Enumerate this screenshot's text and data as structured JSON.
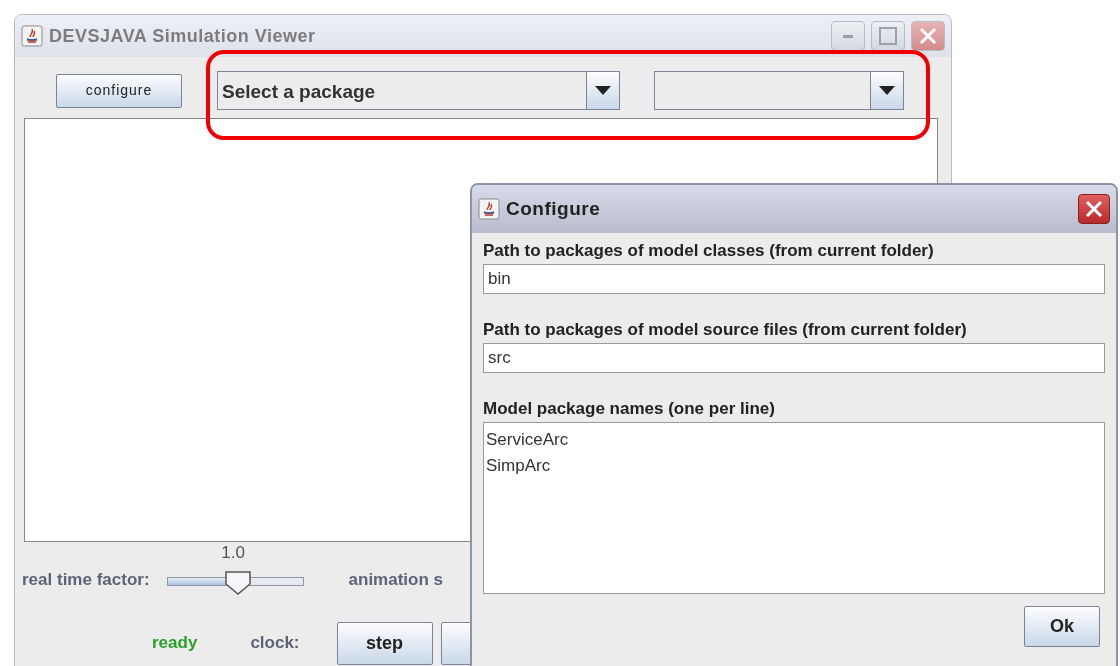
{
  "main_window": {
    "title": "DEVSJAVA Simulation Viewer",
    "configure_button": "configure",
    "package_dropdown": {
      "value": "Select a package"
    },
    "real_time_factor": {
      "label": "real time factor:",
      "reading": "1.0",
      "level": 0.52
    },
    "animation_label": "animation s",
    "status": "ready",
    "clock_label": "clock:",
    "step_button": "step"
  },
  "configure_dialog": {
    "title": "Configure",
    "fields": [
      {
        "label": "Path to packages of model classes (from current folder)",
        "value": "bin"
      },
      {
        "label": "Path to packages of model source files (from current folder)",
        "value": "src"
      }
    ],
    "packages_label": "Model package names (one per line)",
    "package_names": [
      "ServiceArc",
      "SimpArc"
    ],
    "ok_button": "Ok"
  }
}
